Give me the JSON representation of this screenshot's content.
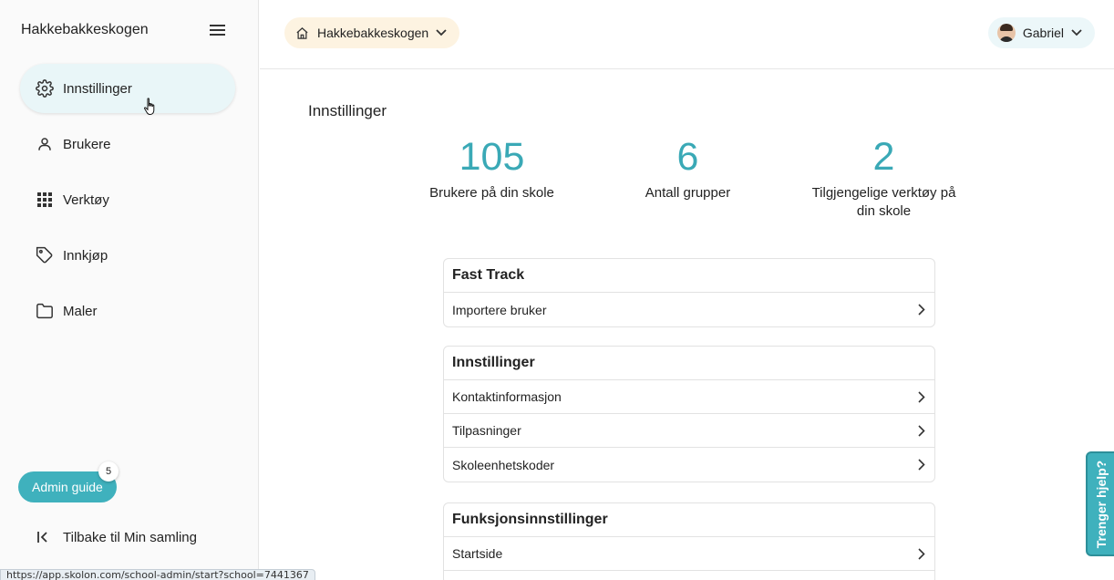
{
  "sidebar": {
    "brand": "Hakkebakkeskogen",
    "items": [
      {
        "label": "Innstillinger",
        "icon": "gear-icon",
        "active": true
      },
      {
        "label": "Brukere",
        "icon": "person-icon",
        "active": false
      },
      {
        "label": "Verktøy",
        "icon": "grid-icon",
        "active": false
      },
      {
        "label": "Innkjøp",
        "icon": "tag-icon",
        "active": false
      },
      {
        "label": "Maler",
        "icon": "folder-icon",
        "active": false
      }
    ],
    "admin_guide": {
      "label": "Admin guide",
      "badge": "5"
    },
    "back_label": "Tilbake til Min samling"
  },
  "topbar": {
    "school": "Hakkebakkeskogen",
    "user": "Gabriel"
  },
  "main": {
    "title": "Innstillinger",
    "stats": [
      {
        "value": "105",
        "label": "Brukere på din skole"
      },
      {
        "value": "6",
        "label": "Antall grupper"
      },
      {
        "value": "2",
        "label": "Tilgjengelige verktøy på din skole"
      }
    ],
    "sections": [
      {
        "title": "Fast Track",
        "rows": [
          "Importere bruker"
        ]
      },
      {
        "title": "Innstillinger",
        "rows": [
          "Kontaktinformasjon",
          "Tilpasninger",
          "Skoleenhetskoder"
        ]
      },
      {
        "title": "Funksjonsinnstillinger",
        "rows": [
          "Startside"
        ]
      }
    ]
  },
  "help_tab": "Trenger hjelp?",
  "status_url": "https://app.skolon.com/school-admin/start?school=7441367",
  "colors": {
    "accent": "#3fb1bd",
    "stat_value": "#3aa9b6",
    "active_nav_bg": "#e9f6f8",
    "school_select_bg": "#fdf3e1"
  }
}
